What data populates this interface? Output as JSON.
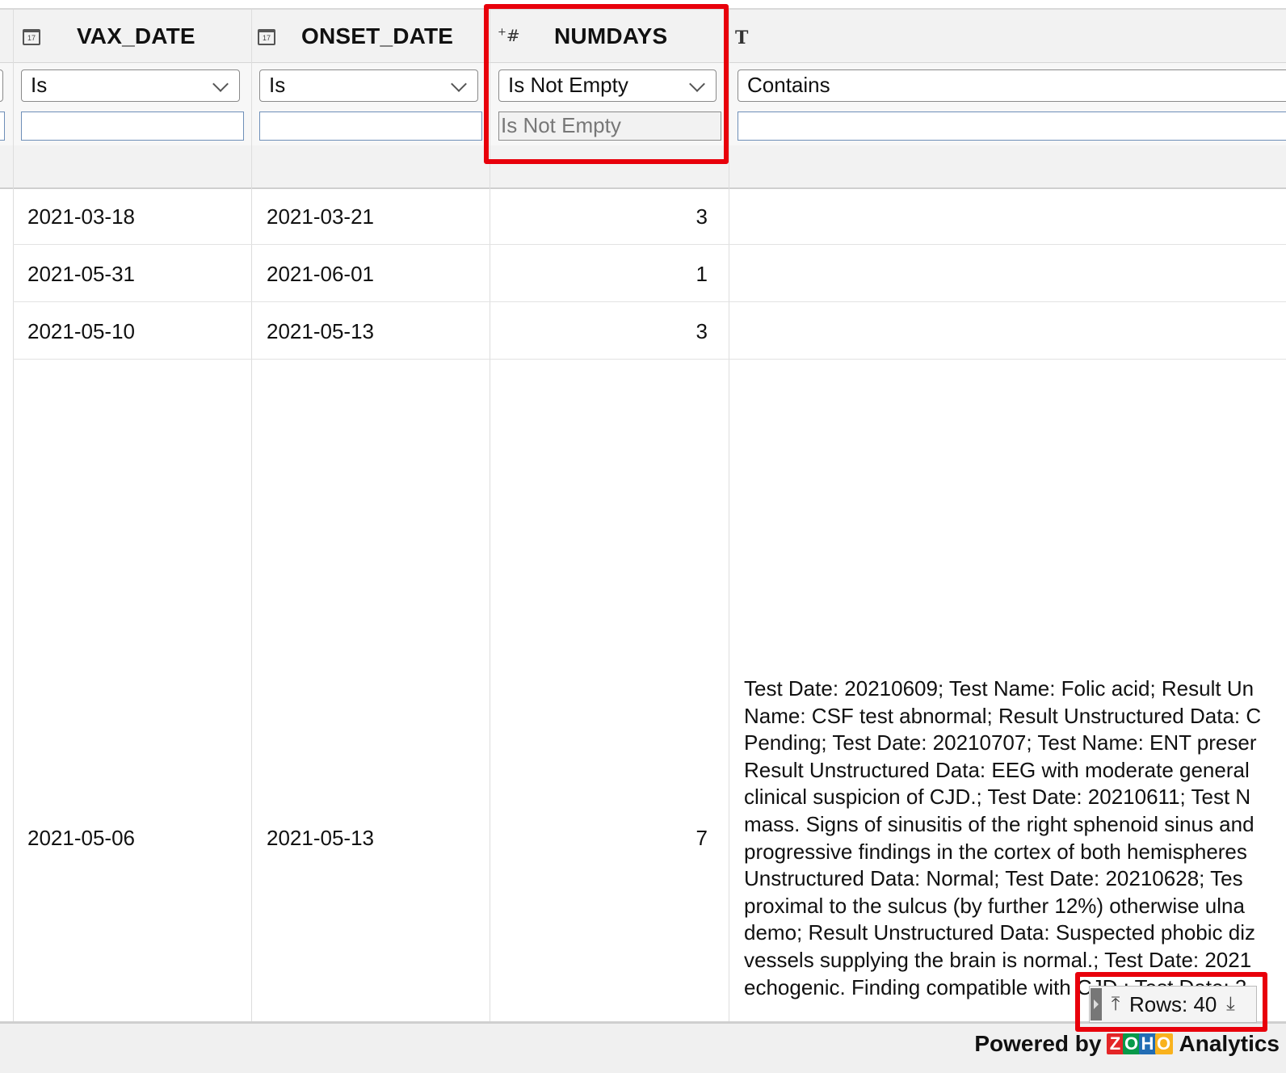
{
  "columns": [
    {
      "title": "VAX_DATE",
      "type_icon": "calendar-icon",
      "type_icon_text": "17",
      "filter_operator": "Is",
      "filter_value": ""
    },
    {
      "title": "ONSET_DATE",
      "type_icon": "calendar-icon",
      "type_icon_text": "17",
      "filter_operator": "Is",
      "filter_value": ""
    },
    {
      "title": "NUMDAYS",
      "type_icon": "number-icon",
      "type_icon_text": "#",
      "filter_operator": "Is Not Empty",
      "filter_value": "Is Not Empty"
    },
    {
      "title": "",
      "type_icon": "text-type-icon",
      "type_icon_text": "T",
      "filter_operator": "Contains",
      "filter_value": ""
    }
  ],
  "rows": [
    {
      "vax_date": "2021-03-18",
      "onset_date": "2021-03-21",
      "numdays": "3",
      "text": ""
    },
    {
      "vax_date": "2021-05-31",
      "onset_date": "2021-06-01",
      "numdays": "1",
      "text": ""
    },
    {
      "vax_date": "2021-05-10",
      "onset_date": "2021-05-13",
      "numdays": "3",
      "text": ""
    },
    {
      "vax_date": "2021-05-06",
      "onset_date": "2021-05-13",
      "numdays": "7",
      "text_lines": [
        "Test Date: 20210609; Test Name: Folic acid; Result Un",
        "Name: CSF test abnormal; Result Unstructured Data: C",
        "Pending; Test Date: 20210707; Test Name: ENT preser",
        "Result Unstructured Data: EEG with moderate general",
        "clinical suspicion of CJD.; Test Date: 20210611; Test N",
        "mass. Signs of sinusitis of the right sphenoid sinus and",
        "progressive findings in the cortex of both hemispheres",
        "Unstructured Data: Normal; Test Date: 20210628; Tes",
        "proximal to the sulcus (by further 12%) otherwise ulna",
        "demo; Result Unstructured Data: Suspected phobic diz",
        "vessels supplying the brain is normal.; Test Date: 2021",
        "echogenic. Finding compatible with CJD.; Test Date: 2"
      ]
    }
  ],
  "rows_widget": {
    "label": "Rows: 40"
  },
  "footer": {
    "powered_by": "Powered by",
    "brand_letters": [
      "Z",
      "O",
      "H",
      "O"
    ],
    "brand_colors": [
      "#e42527",
      "#089949",
      "#226db4",
      "#f9b21d"
    ],
    "product": "Analytics"
  },
  "colors": {
    "highlight": "#e8000b",
    "header_bg": "#f2f2f2"
  }
}
